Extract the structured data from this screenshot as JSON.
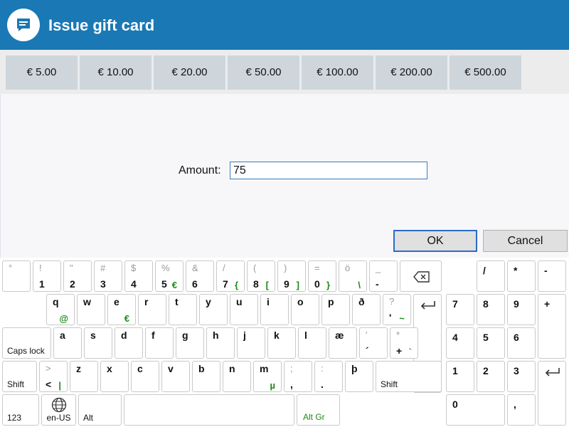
{
  "header": {
    "title": "Issue gift card",
    "icon": "chat-bubble-icon",
    "color": "#1a78b5"
  },
  "denominations": [
    "€ 5.00",
    "€ 10.00",
    "€ 20.00",
    "€ 50.00",
    "€ 100.00",
    "€ 200.00",
    "€ 500.00"
  ],
  "form": {
    "amount_label": "Amount:",
    "amount_value": "75"
  },
  "buttons": {
    "ok": "OK",
    "cancel": "Cancel"
  },
  "keyboard": {
    "row1": [
      {
        "top": "°",
        "bottom": ""
      },
      {
        "top": "!",
        "bottom": "1"
      },
      {
        "top": "\"",
        "bottom": "2"
      },
      {
        "top": "#",
        "bottom": "3"
      },
      {
        "top": "$",
        "bottom": "4"
      },
      {
        "top": "%",
        "bottom": "5",
        "alt": "€"
      },
      {
        "top": "&",
        "bottom": "6"
      },
      {
        "top": "/",
        "bottom": "7",
        "alt": "{"
      },
      {
        "top": "(",
        "bottom": "8",
        "alt": "["
      },
      {
        "top": ")",
        "bottom": "9",
        "alt": "]"
      },
      {
        "top": "=",
        "bottom": "0",
        "alt": "}"
      },
      {
        "top": "ö",
        "bottom": "",
        "alt": "\\"
      },
      {
        "top": "_",
        "bottom": "-"
      }
    ],
    "row2": [
      {
        "main": "q",
        "alt": "@"
      },
      {
        "main": "w"
      },
      {
        "main": "e",
        "alt": "€"
      },
      {
        "main": "r"
      },
      {
        "main": "t"
      },
      {
        "main": "y"
      },
      {
        "main": "u"
      },
      {
        "main": "i"
      },
      {
        "main": "o"
      },
      {
        "main": "p"
      },
      {
        "main": "ð"
      },
      {
        "top": "?",
        "bottom": "'",
        "alt": "~"
      }
    ],
    "row3": [
      {
        "main": "a"
      },
      {
        "main": "s"
      },
      {
        "main": "d"
      },
      {
        "main": "f"
      },
      {
        "main": "g"
      },
      {
        "main": "h"
      },
      {
        "main": "j"
      },
      {
        "main": "k"
      },
      {
        "main": "l"
      },
      {
        "main": "æ"
      },
      {
        "top": "'",
        "bottom": "´"
      },
      {
        "top": "*",
        "bottom": "+",
        "alt": "`"
      }
    ],
    "row4": [
      {
        "top": ">",
        "bottom": "<",
        "alt": "|"
      },
      {
        "main": "z"
      },
      {
        "main": "x"
      },
      {
        "main": "c"
      },
      {
        "main": "v"
      },
      {
        "main": "b"
      },
      {
        "main": "n"
      },
      {
        "main": "m",
        "alt": "µ"
      },
      {
        "top": ";",
        "bottom": ","
      },
      {
        "top": ":",
        "bottom": "."
      },
      {
        "main": "þ"
      }
    ],
    "labels": {
      "caps_lock": "Caps lock",
      "shift": "Shift",
      "num": "123",
      "lang": "en-US",
      "alt": "Alt",
      "altgr": "Alt Gr"
    },
    "numpad": {
      "row1": [
        "/",
        "*",
        "-"
      ],
      "row2": [
        "7",
        "8",
        "9",
        "+"
      ],
      "row3": [
        "4",
        "5",
        "6"
      ],
      "row4": [
        "1",
        "2",
        "3"
      ],
      "row5": [
        "0",
        ","
      ]
    }
  }
}
